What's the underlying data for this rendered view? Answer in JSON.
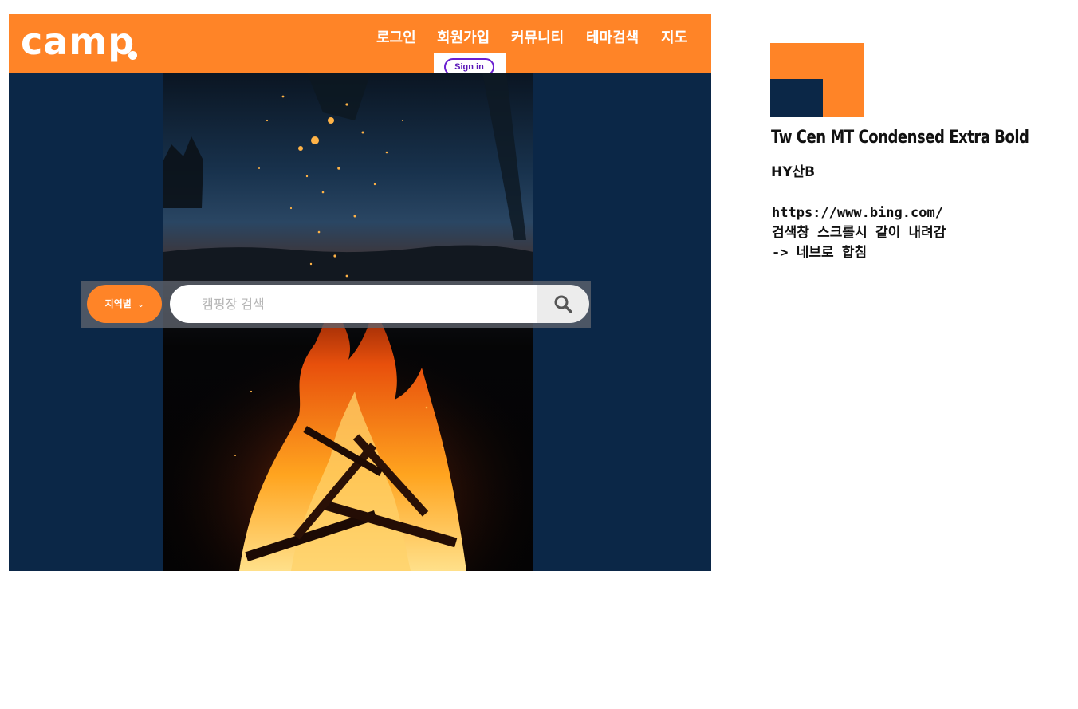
{
  "header": {
    "logo": "camp",
    "nav": [
      "로그인",
      "회원가입",
      "커뮤니티",
      "테마검색",
      "지도"
    ],
    "signin_label": "Sign in"
  },
  "search": {
    "region_label": "지역별",
    "placeholder": "캠핑장 검색",
    "value": ""
  },
  "side_notes": {
    "font_primary": "Tw Cen MT Condensed Extra Bold",
    "font_secondary": "HY산B",
    "lines": [
      "https://www.bing.com/",
      "검색창 스크롤시 같이 내려감",
      "-> 네브로 합침"
    ]
  },
  "colors": {
    "brand_orange": "#ff8427",
    "navy": "#0b2747",
    "signin_purple": "#6a1fd1"
  },
  "icons": [
    "chevron-down-icon",
    "search-icon"
  ]
}
